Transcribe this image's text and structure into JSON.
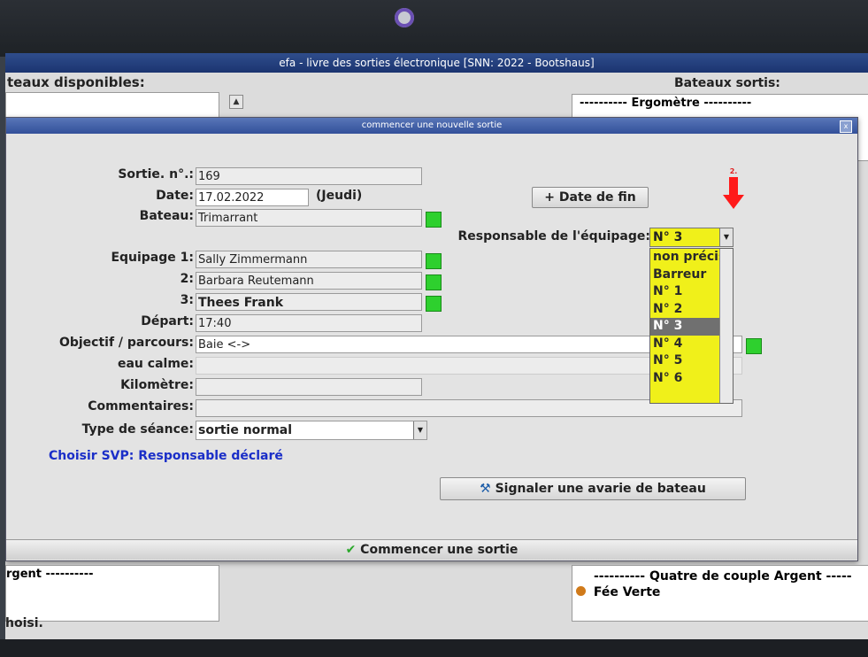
{
  "main_window": {
    "title": "efa - livre des sorties électronique [SNN: 2022 - Bootshaus]",
    "left_header": "teaux disponibles:",
    "right_header": "Bateaux sortis:",
    "right_list_top": "---------- Ergomètre ----------",
    "left_bottom_item": "rgent ----------",
    "right_bottom_item_1": "---------- Quatre de couple Argent -----",
    "right_bottom_item_2": "Fée Verte",
    "status": "hoisi."
  },
  "dialog": {
    "title": "commencer une nouvelle sortie",
    "close": "x",
    "labels": {
      "sortie": "Sortie. n°.:",
      "date": "Date:",
      "bateau": "Bateau:",
      "responsable": "Responsable de l'équipage:",
      "equipage1": "Equipage 1:",
      "equipage2": "2:",
      "equipage3": "3:",
      "depart": "Départ:",
      "objectif": "Objectif / parcours:",
      "eau": "eau calme:",
      "kilometre": "Kilomètre:",
      "commentaires": "Commentaires:",
      "type": "Type de séance:"
    },
    "values": {
      "sortie": "169",
      "date": "17.02.2022",
      "day": "(Jeudi)",
      "bateau": "Trimarrant",
      "equipage1": "Sally Zimmermann",
      "equipage2": "Barbara Reutemann",
      "equipage3": "Thees Frank",
      "depart": "17:40",
      "objectif": "Baie <->",
      "eau": "",
      "kilometre": "",
      "commentaires": "",
      "type": "sortie normal"
    },
    "date_fin_button": "+ Date de fin",
    "responsable_selected": "N° 3",
    "responsable_options": [
      "non précis",
      "Barreur",
      "N° 1",
      "N° 2",
      "N° 3",
      "N° 4",
      "N° 5",
      "N° 6"
    ],
    "annotation": "2.",
    "note": "Choisir SVP: Responsable déclaré",
    "avarie_button": "Signaler une avarie de bateau",
    "start_button": "Commencer une sortie"
  }
}
